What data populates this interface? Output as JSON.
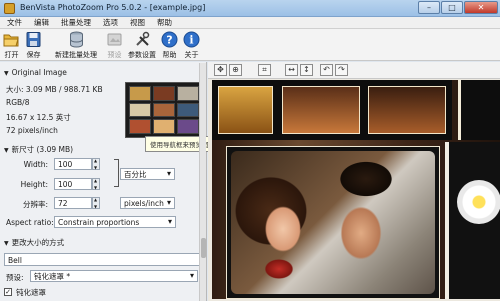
{
  "window": {
    "title": "BenVista PhotoZoom Pro 5.0.2 - [example.jpg]",
    "controls": [
      "–",
      "□",
      "✕"
    ]
  },
  "menu": [
    "文件",
    "编辑",
    "批量处理",
    "选项",
    "视图",
    "帮助"
  ],
  "toolbar": {
    "buttons": [
      {
        "label": "打开",
        "icon": "open-folder-icon",
        "enabled": true
      },
      {
        "label": "保存",
        "icon": "save-disk-icon",
        "enabled": true
      },
      {
        "label": "新建批量处理",
        "icon": "batch-database-icon",
        "enabled": true
      },
      {
        "label": "预设",
        "icon": "preset-icon",
        "enabled": false
      },
      {
        "label": "参数设置",
        "icon": "tools-icon",
        "enabled": true
      },
      {
        "label": "帮助",
        "icon": "help-icon",
        "enabled": true
      },
      {
        "label": "关于",
        "icon": "info-icon",
        "enabled": true
      }
    ]
  },
  "original_image": {
    "heading": "Original Image",
    "size": "大小: 3.09 MB / 988.71 KB",
    "mode": "RGB/8",
    "dimensions": "16.67 x 12.5 英寸",
    "resolution": "72 pixels/inch"
  },
  "tooltip": "使用导航框来预览图像的不同部分",
  "new_size": {
    "heading": "新尺寸 (3.09 MB)",
    "width_label": "Width:",
    "width_value": "100",
    "height_label": "Height:",
    "height_value": "100",
    "unit_value": "百分比",
    "resolution_label": "分辨率:",
    "resolution_value": "72",
    "resolution_unit": "pixels/inch",
    "aspect_label": "Aspect ratio:",
    "aspect_value": "Constrain proportions"
  },
  "resize_method": {
    "heading": "更改大小的方式",
    "method": "Bell",
    "preset_label": "预设:",
    "preset_value": "钝化遮罩 *",
    "checkbox_label": "钝化遮罩",
    "checkbox_checked": true
  },
  "view_tools": [
    "✥",
    "⊕",
    "⌗",
    "↔",
    "↕",
    "↶",
    "↷"
  ],
  "colors": {
    "titlebar": "#9cc0e6",
    "panel": "#eef0f3",
    "preview_border": "#f3efe4"
  }
}
